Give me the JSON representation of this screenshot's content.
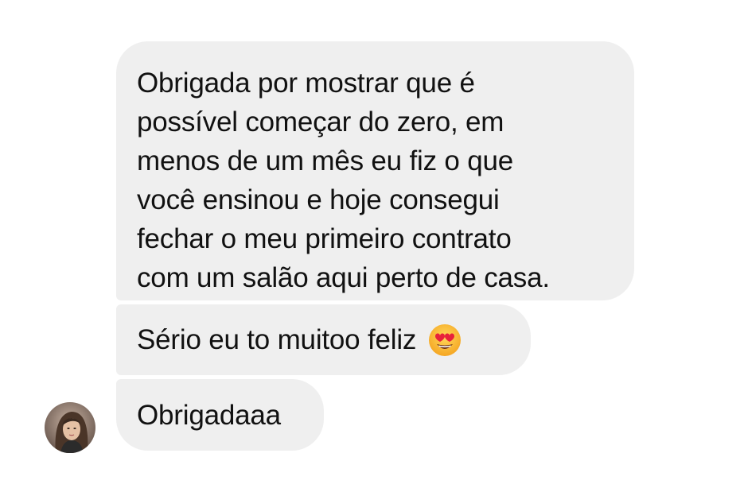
{
  "messages": [
    {
      "lines": [
        "Obrigada por mostrar que é",
        "possível começar do zero, em",
        "menos de um mês eu fiz o que",
        "você ensinou e hoje consegui",
        "fechar o meu primeiro contrato",
        "com um salão aqui perto de casa."
      ]
    },
    {
      "text": "Sério eu to muitoo feliz",
      "emoji": "heart-eyes-emoji"
    },
    {
      "text": "Obrigadaaa"
    }
  ],
  "sender": {
    "avatar_icon": "user-avatar-photo"
  },
  "colors": {
    "bubble_background": "#efefef",
    "text": "#111111",
    "page_background": "#ffffff"
  }
}
